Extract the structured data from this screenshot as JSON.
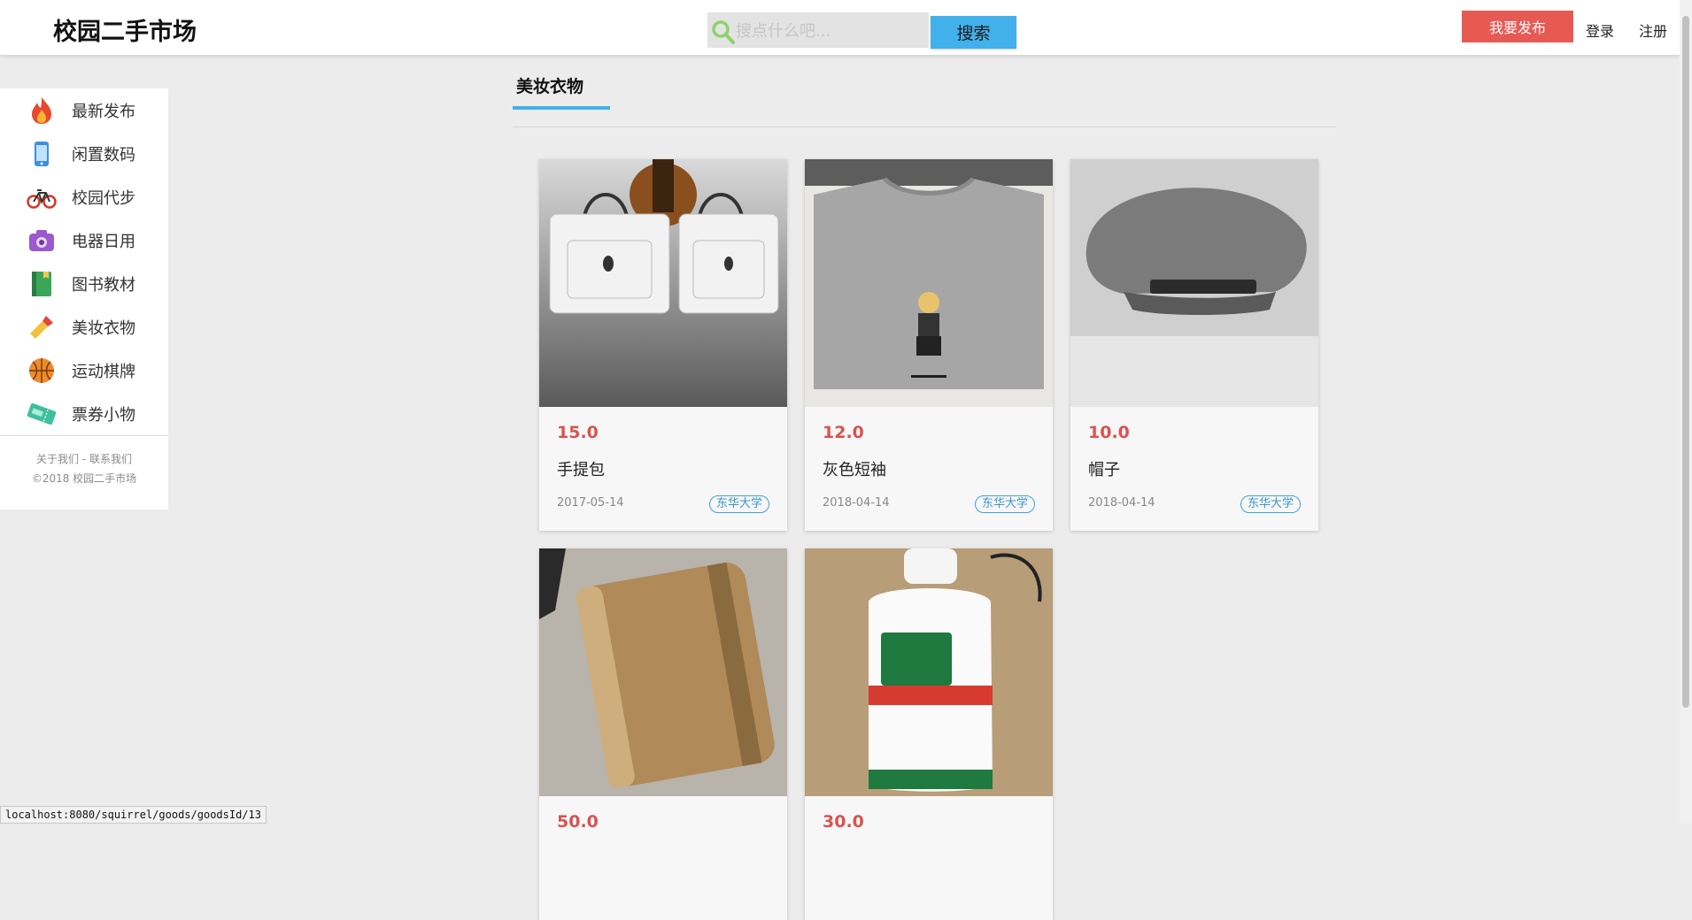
{
  "header": {
    "brand": "校园二手市场",
    "search_placeholder": "搜点什么吧...",
    "search_button": "搜索",
    "publish_button": "我要发布",
    "login": "登录",
    "register": "注册"
  },
  "sidebar": {
    "items": [
      {
        "label": "最新发布",
        "icon": "fire-icon"
      },
      {
        "label": "闲置数码",
        "icon": "phone-icon"
      },
      {
        "label": "校园代步",
        "icon": "bicycle-icon"
      },
      {
        "label": "电器日用",
        "icon": "camera-icon"
      },
      {
        "label": "图书教材",
        "icon": "book-icon"
      },
      {
        "label": "美妆衣物",
        "icon": "lipstick-icon"
      },
      {
        "label": "运动棋牌",
        "icon": "basketball-icon"
      },
      {
        "label": "票券小物",
        "icon": "ticket-icon"
      }
    ],
    "footer_links": "关于我们 - 联系我们",
    "copyright": "©2018 校园二手市场"
  },
  "main": {
    "section_title": "美妆衣物",
    "goods": [
      {
        "price": "15.0",
        "name": "手提包",
        "date": "2017-05-14",
        "school": "东华大学",
        "image": "handbag-photo"
      },
      {
        "price": "12.0",
        "name": "灰色短袖",
        "date": "2018-04-14",
        "school": "东华大学",
        "image": "grey-tshirt-photo"
      },
      {
        "price": "10.0",
        "name": "帽子",
        "date": "2018-04-14",
        "school": "东华大学",
        "image": "grey-cap-photo"
      },
      {
        "price": "50.0",
        "name": "",
        "date": "",
        "school": "",
        "image": "sunscreen-bottle-photo"
      },
      {
        "price": "30.0",
        "name": "",
        "date": "",
        "school": "",
        "image": "contact-solution-photo"
      }
    ]
  },
  "status_bar": "localhost:8080/squirrel/goods/goodsId/13",
  "colors": {
    "accent": "#42b0ea",
    "publish": "#e75a54",
    "price": "#d9534f"
  }
}
